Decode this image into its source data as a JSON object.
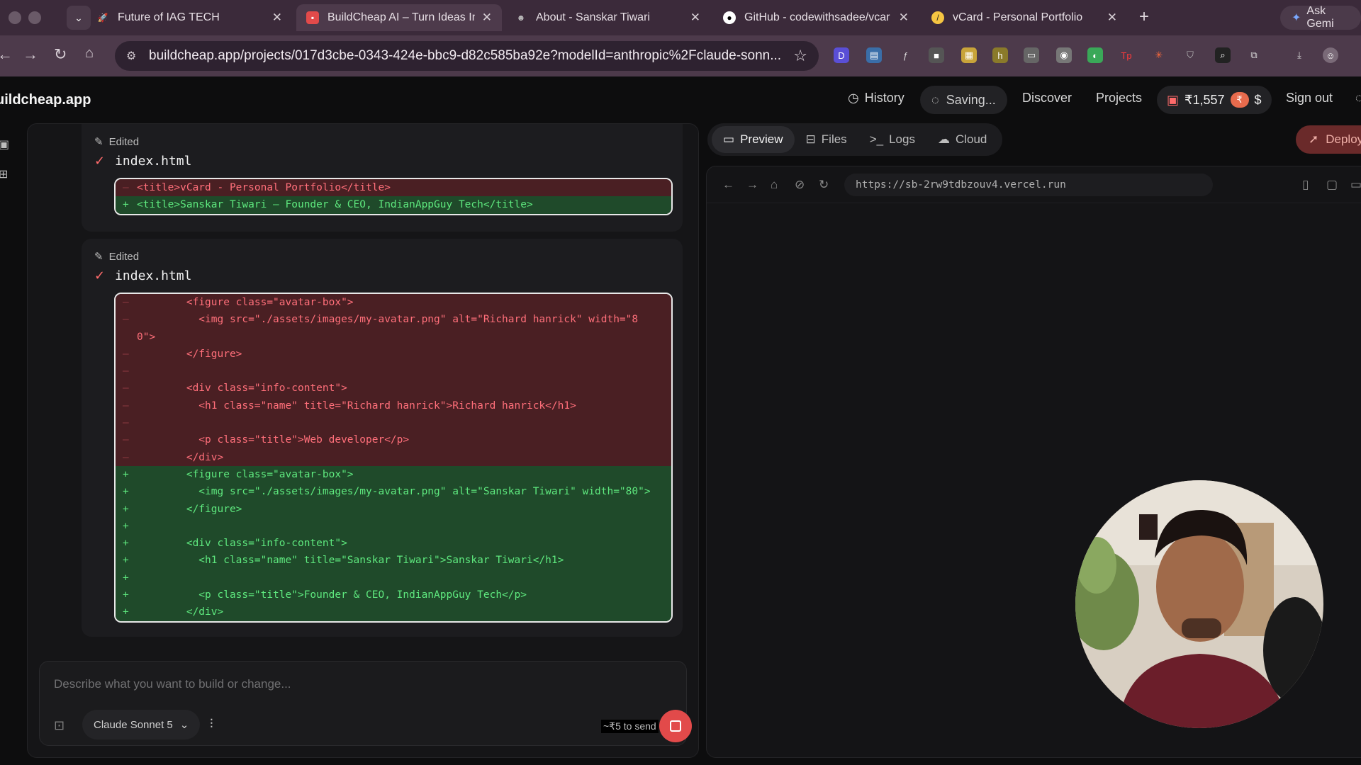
{
  "browser": {
    "tabs": [
      {
        "title": "Future of IAG TECH",
        "active": false
      },
      {
        "title": "BuildCheap AI – Turn Ideas In",
        "active": true
      },
      {
        "title": "About - Sanskar Tiwari",
        "active": false
      },
      {
        "title": "GitHub - codewithsadee/vcar",
        "active": false
      },
      {
        "title": "vCard - Personal Portfolio",
        "active": false
      }
    ],
    "ask_gemini": "Ask Gemi",
    "url": "buildcheap.app/projects/017d3cbe-0343-424e-bbc9-d82c585ba92e?modelId=anthropic%2Fclaude-sonn..."
  },
  "header": {
    "logo": "uildcheap.app",
    "history": "History",
    "saving": "Saving...",
    "discover": "Discover",
    "projects": "Projects",
    "credits": "₹1,557",
    "currency": "$",
    "signout": "Sign out"
  },
  "chat": {
    "edits": [
      {
        "status": "Edited",
        "file": "index.html",
        "lines": [
          {
            "t": "del",
            "s": "–",
            "c": "<title>vCard - Personal Portfolio</title>"
          },
          {
            "t": "add",
            "s": "+",
            "c": "<title>Sanskar Tiwari – Founder & CEO, IndianAppGuy Tech</title>"
          }
        ]
      },
      {
        "status": "Edited",
        "file": "index.html",
        "lines": [
          {
            "t": "del",
            "s": "–",
            "c": "        <figure class=\"avatar-box\">"
          },
          {
            "t": "del",
            "s": "–",
            "c": "          <img src=\"./assets/images/my-avatar.png\" alt=\"Richard hanrick\" width=\"8"
          },
          {
            "t": "del",
            "s": "",
            "c": "0\">"
          },
          {
            "t": "del",
            "s": "–",
            "c": "        </figure>"
          },
          {
            "t": "del",
            "s": "–",
            "c": ""
          },
          {
            "t": "del",
            "s": "–",
            "c": "        <div class=\"info-content\">"
          },
          {
            "t": "del",
            "s": "–",
            "c": "          <h1 class=\"name\" title=\"Richard hanrick\">Richard hanrick</h1>"
          },
          {
            "t": "del",
            "s": "–",
            "c": ""
          },
          {
            "t": "del",
            "s": "–",
            "c": "          <p class=\"title\">Web developer</p>"
          },
          {
            "t": "del",
            "s": "–",
            "c": "        </div>"
          },
          {
            "t": "add",
            "s": "+",
            "c": "        <figure class=\"avatar-box\">"
          },
          {
            "t": "add",
            "s": "+",
            "c": "          <img src=\"./assets/images/my-avatar.png\" alt=\"Sanskar Tiwari\" width=\"80\">"
          },
          {
            "t": "add",
            "s": "+",
            "c": "        </figure>"
          },
          {
            "t": "add",
            "s": "+",
            "c": ""
          },
          {
            "t": "add",
            "s": "+",
            "c": "        <div class=\"info-content\">"
          },
          {
            "t": "add",
            "s": "+",
            "c": "          <h1 class=\"name\" title=\"Sanskar Tiwari\">Sanskar Tiwari</h1>"
          },
          {
            "t": "add",
            "s": "+",
            "c": ""
          },
          {
            "t": "add",
            "s": "+",
            "c": "          <p class=\"title\">Founder & CEO, IndianAppGuy Tech</p>"
          },
          {
            "t": "add",
            "s": "+",
            "c": "        </div>"
          }
        ]
      }
    ],
    "composer_placeholder": "Describe what you want to build or change...",
    "model": "Claude Sonnet 5",
    "cost": "~₹5 to send"
  },
  "preview": {
    "tabs": [
      "Preview",
      "Files",
      "Logs",
      "Cloud"
    ],
    "deploy": "Deploy",
    "url": "https://sb-2rw9tdbzouv4.vercel.run"
  },
  "colors": {
    "accent": "#e24a4a",
    "diff_del_bg": "#4a1f23",
    "diff_add_bg": "#1f4a2a"
  }
}
